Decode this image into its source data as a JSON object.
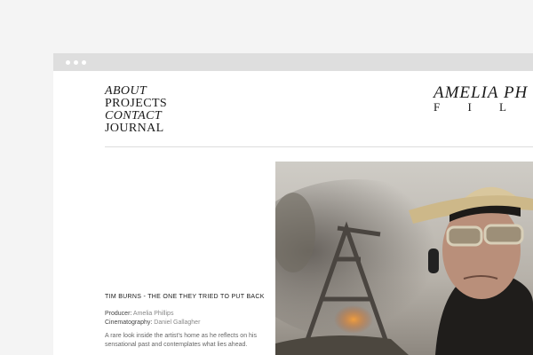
{
  "nav": {
    "items": [
      {
        "label": "ABOUT"
      },
      {
        "label": "PROJECTS"
      },
      {
        "label": "CONTACT"
      },
      {
        "label": "JOURNAL"
      }
    ]
  },
  "logo": {
    "name": "AMELIA PH",
    "sub": "F I L M M"
  },
  "project": {
    "title": "TIM BURNS - THE ONE THEY TRIED TO PUT BACK",
    "producer_label": "Producer:",
    "producer": "Amelia Phillips",
    "cinematography_label": "Cinematography:",
    "cinematography": "Daniel Gallagher",
    "description": "A rare look inside the artist's home as he reflects on his sensational past and contemplates what lies ahead."
  },
  "colors": {
    "page_bg": "#f4f4f4",
    "chrome_bar": "#dedede",
    "text": "#1a1a1a",
    "muted": "#888888"
  }
}
